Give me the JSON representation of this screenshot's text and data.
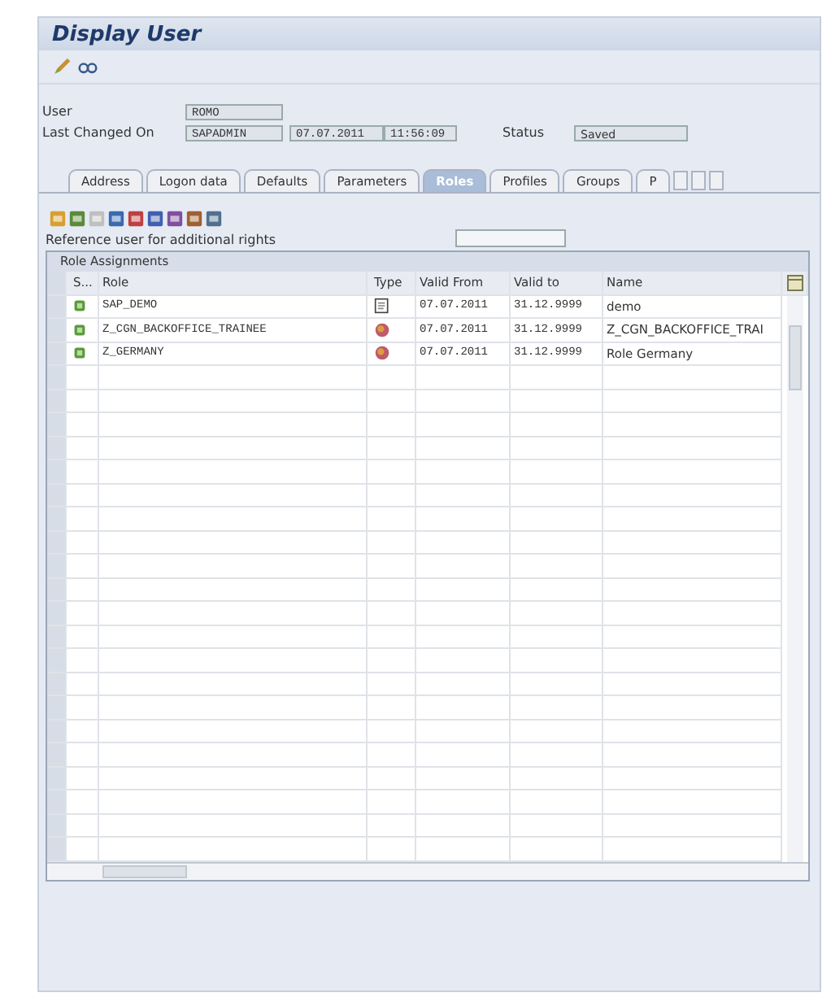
{
  "window": {
    "title": "Display User"
  },
  "fields": [
    {
      "label": "User",
      "values": [
        "ROMO"
      ]
    },
    {
      "label": "Last Changed On",
      "values": [
        "SAPADMIN",
        "07.07.2011",
        "11:56:09"
      ],
      "status_label": "Status",
      "status_value": "Saved"
    }
  ],
  "tabs": [
    {
      "label": "Address",
      "selected": false
    },
    {
      "label": "Logon data",
      "selected": false
    },
    {
      "label": "Defaults",
      "selected": false
    },
    {
      "label": "Parameters",
      "selected": false
    },
    {
      "label": "Roles",
      "selected": true
    },
    {
      "label": "Profiles",
      "selected": false
    },
    {
      "label": "Groups",
      "selected": false
    },
    {
      "label": "P",
      "selected": false
    }
  ],
  "reference": {
    "label": "Reference user for additional rights"
  },
  "table": {
    "title": "Role Assignments",
    "columns": [
      "S...",
      "Role",
      "Type",
      "Valid From",
      "Valid to",
      "Name"
    ],
    "rows": [
      {
        "role": "SAP_DEMO",
        "kind": "single",
        "valid_from": "07.07.2011",
        "valid_to": "31.12.9999",
        "name": "demo"
      },
      {
        "role": "Z_CGN_BACKOFFICE_TRAINEE",
        "kind": "composite",
        "valid_from": "07.07.2011",
        "valid_to": "31.12.9999",
        "name": "Z_CGN_BACKOFFICE_TRAI"
      },
      {
        "role": "Z_GERMANY",
        "kind": "composite",
        "valid_from": "07.07.2011",
        "valid_to": "31.12.9999",
        "name": "Role Germany"
      }
    ]
  }
}
